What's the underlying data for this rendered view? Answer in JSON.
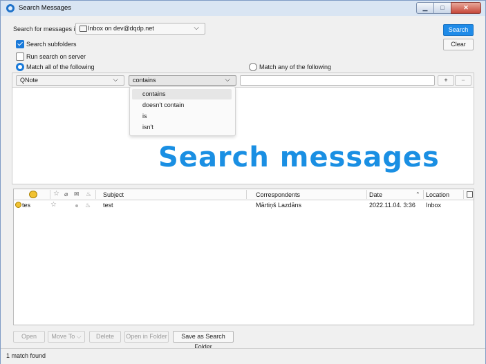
{
  "window": {
    "title": "Search Messages",
    "buttons": {
      "minimize": "▁",
      "maximize": "□",
      "close": "✕"
    }
  },
  "search": {
    "folder_label": "Search for messages in:",
    "folder_value": "Inbox on dev@dqdp.net",
    "search_button": "Search",
    "clear_button": "Clear",
    "search_subfolders_label": "Search subfolders",
    "search_subfolders_checked": true,
    "run_on_server_label": "Run search on server",
    "run_on_server_checked": false,
    "match_all_label": "Match all of the following",
    "match_any_label": "Match any of the following",
    "match_mode": "all"
  },
  "criteria": {
    "field_value": "QNote",
    "operator_value": "contains",
    "value_text": "",
    "add_label": "+",
    "remove_label": "−",
    "operator_options": [
      "contains",
      "doesn't contain",
      "is",
      "isn't"
    ],
    "highlighted_option": "contains"
  },
  "overlay_text": "Search messages",
  "results": {
    "columns": {
      "subject": "Subject",
      "correspondents": "Correspondents",
      "date": "Date",
      "location": "Location"
    },
    "rows": [
      {
        "tag": "tes",
        "subject": "test",
        "correspondents": "Mārtiņš Lazdāns",
        "date": "2022.11.04. 3:36",
        "location": "Inbox"
      }
    ]
  },
  "actions": {
    "open": "Open",
    "move_to": "Move To",
    "delete": "Delete",
    "open_in_folder": "Open in Folder",
    "save_as_search_folder": "Save as Search Folder"
  },
  "status": {
    "text": "1 match found"
  },
  "colors": {
    "accent": "#1a7ad9",
    "primary_button": "#1f8be8",
    "overlay_text": "#1a8fe3",
    "tag": "#f1c232"
  }
}
